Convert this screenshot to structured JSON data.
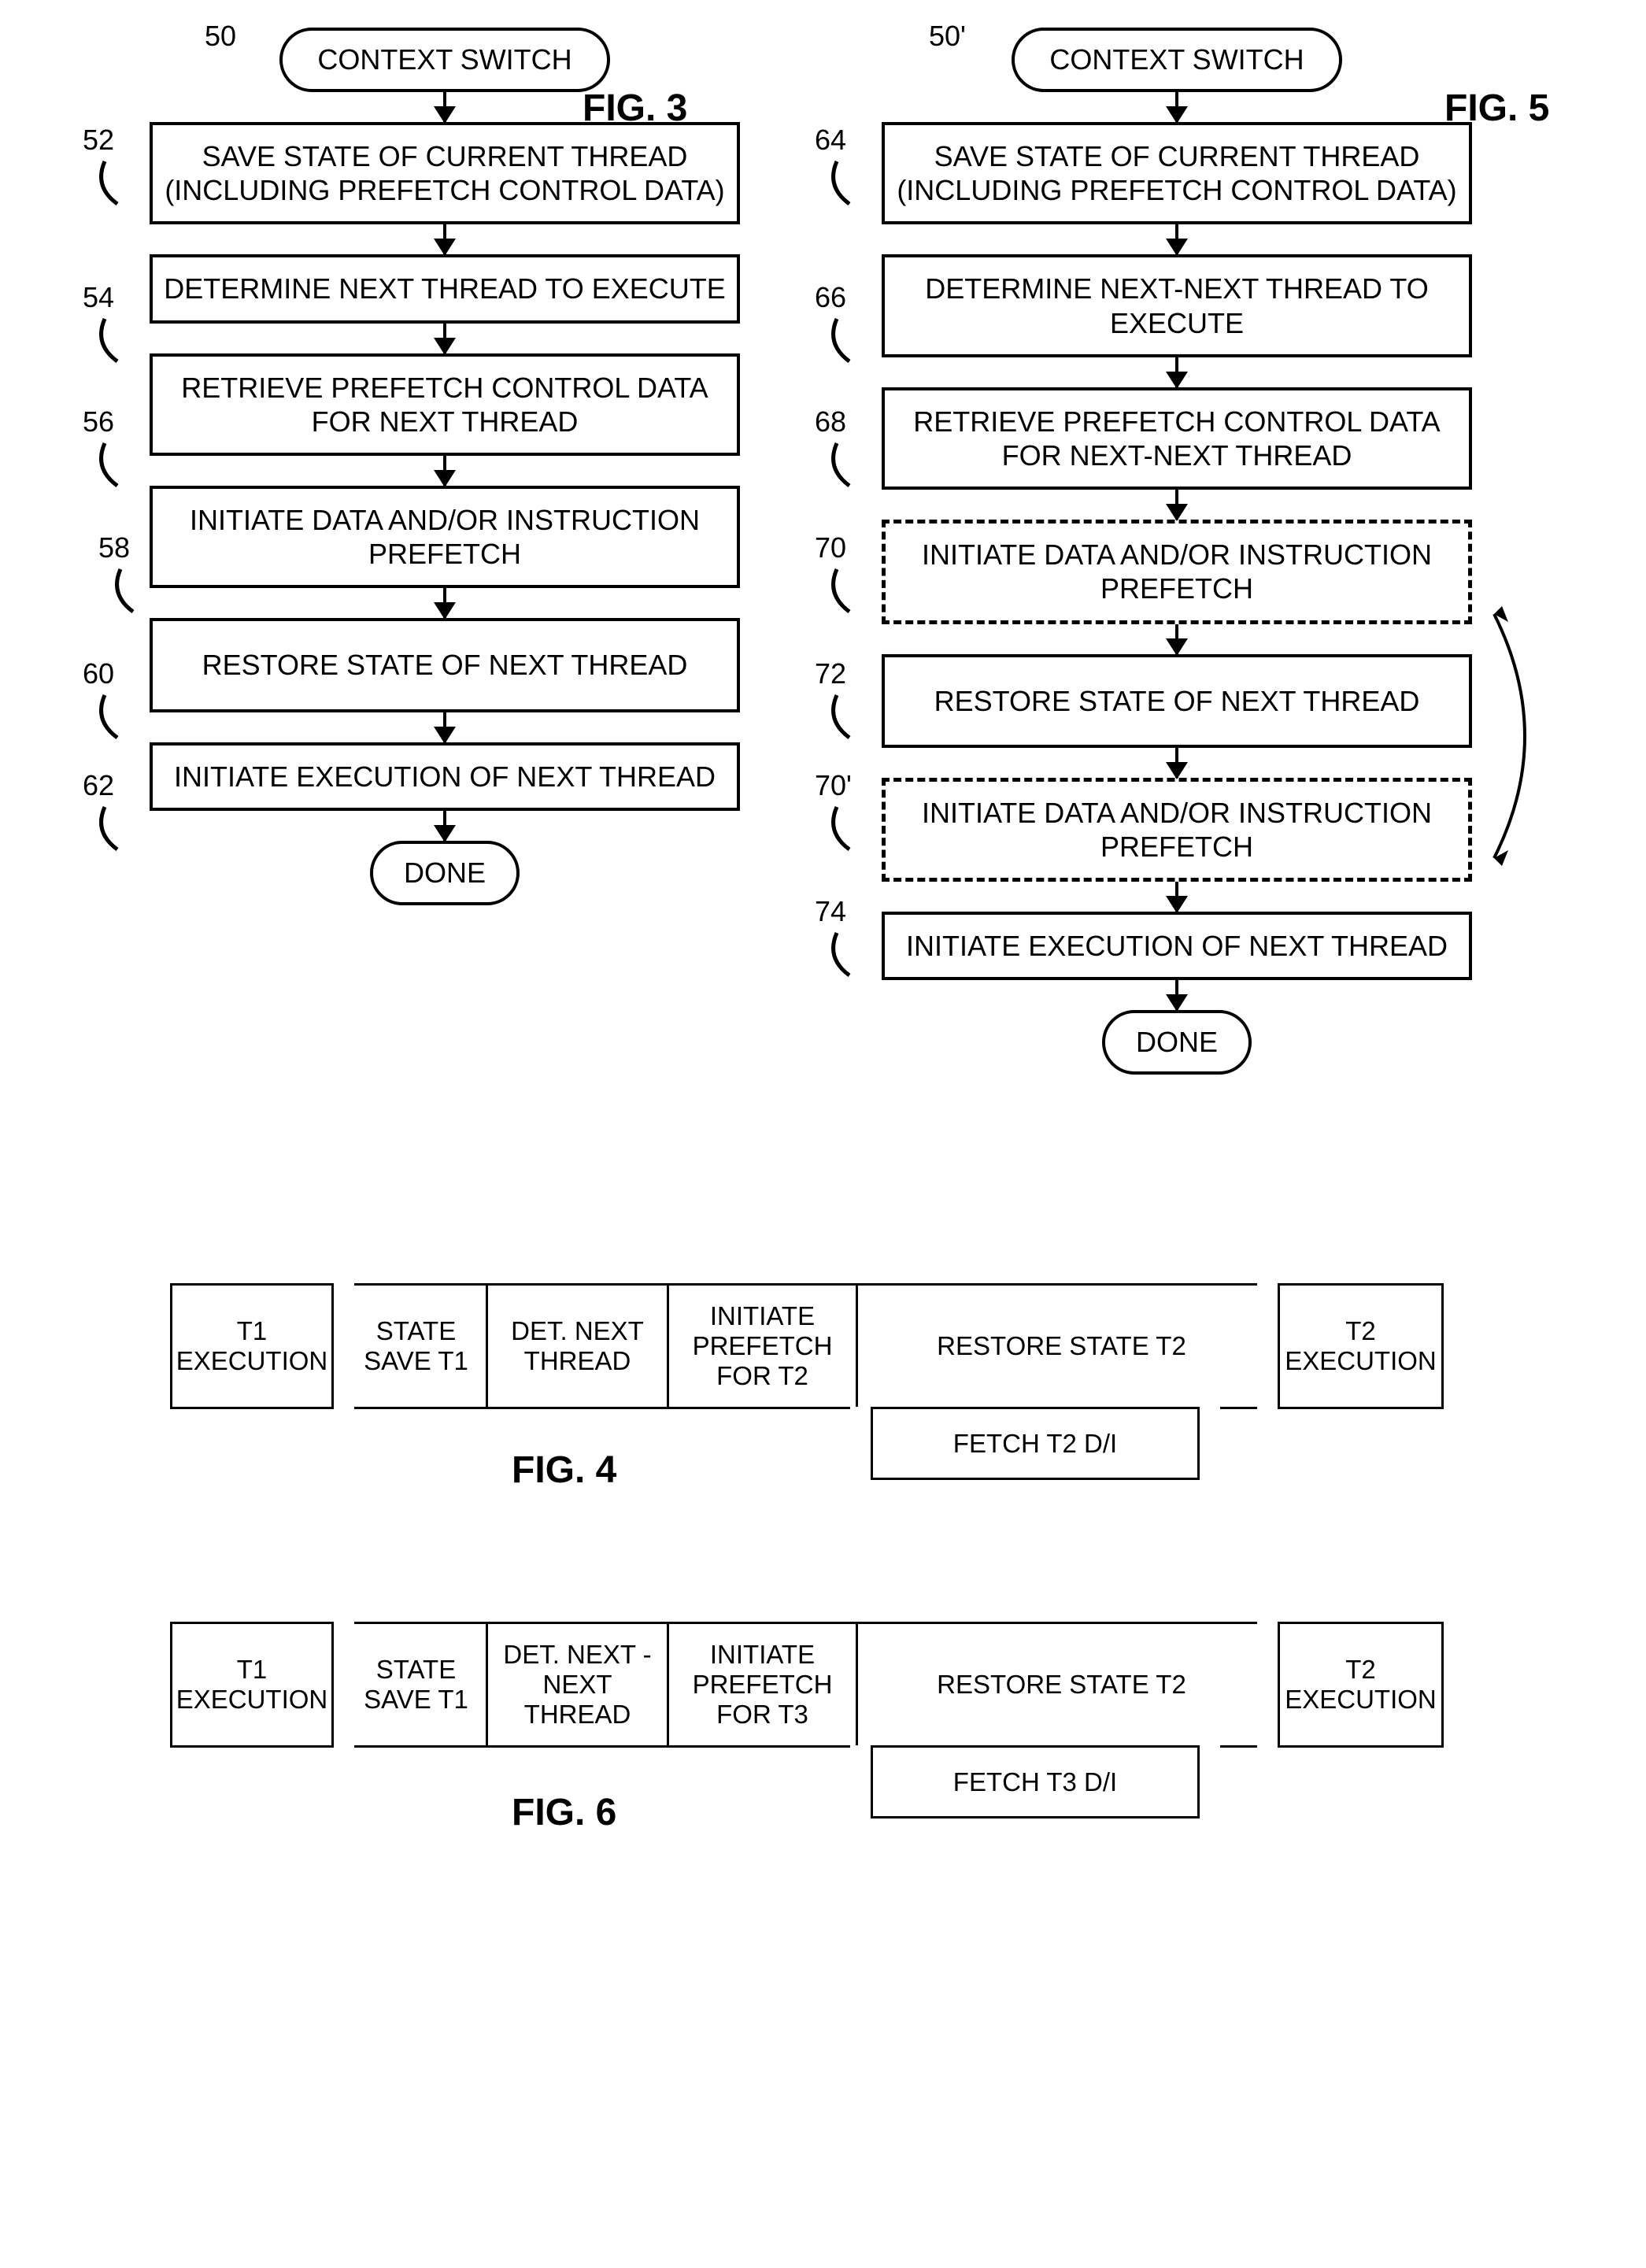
{
  "fig3": {
    "title": "FIG. 3",
    "start_ref": "50",
    "start": "CONTEXT SWITCH",
    "steps": [
      {
        "ref": "52",
        "text": "SAVE STATE OF CURRENT THREAD (INCLUDING PREFETCH CONTROL DATA)"
      },
      {
        "ref": "54",
        "text": "DETERMINE NEXT THREAD TO EXECUTE"
      },
      {
        "ref": "56",
        "text": "RETRIEVE PREFETCH CONTROL DATA FOR NEXT THREAD"
      },
      {
        "ref": "58",
        "text": "INITIATE DATA AND/OR INSTRUCTION PREFETCH"
      },
      {
        "ref": "60",
        "text": "RESTORE STATE OF NEXT THREAD"
      },
      {
        "ref": "62",
        "text": "INITIATE EXECUTION OF NEXT THREAD"
      }
    ],
    "end": "DONE"
  },
  "fig5": {
    "title": "FIG. 5",
    "start_ref": "50'",
    "start": "CONTEXT SWITCH",
    "steps": [
      {
        "ref": "64",
        "text": "SAVE STATE OF CURRENT THREAD (INCLUDING PREFETCH CONTROL DATA)",
        "dashed": false
      },
      {
        "ref": "66",
        "text": "DETERMINE NEXT-NEXT THREAD TO EXECUTE",
        "dashed": false
      },
      {
        "ref": "68",
        "text": "RETRIEVE PREFETCH CONTROL DATA FOR NEXT-NEXT THREAD",
        "dashed": false
      },
      {
        "ref": "70",
        "text": "INITIATE DATA AND/OR INSTRUCTION PREFETCH",
        "dashed": true
      },
      {
        "ref": "72",
        "text": "RESTORE STATE OF NEXT THREAD",
        "dashed": false
      },
      {
        "ref": "70'",
        "text": "INITIATE DATA AND/OR INSTRUCTION PREFETCH",
        "dashed": true
      },
      {
        "ref": "74",
        "text": "INITIATE EXECUTION OF NEXT THREAD",
        "dashed": false
      }
    ],
    "end": "DONE"
  },
  "fig4": {
    "title": "FIG. 4",
    "cells": [
      "T1 EXECUTION",
      "STATE SAVE T1",
      "DET. NEXT THREAD",
      "INITIATE PREFETCH FOR T2",
      "RESTORE STATE T2",
      "T2 EXECUTION"
    ],
    "under": "FETCH T2 D/I"
  },
  "fig6": {
    "title": "FIG. 6",
    "cells": [
      "T1 EXECUTION",
      "STATE SAVE T1",
      "DET. NEXT -NEXT THREAD",
      "INITIATE PREFETCH FOR T3",
      "RESTORE STATE T2",
      "T2 EXECUTION"
    ],
    "under": "FETCH T3 D/I"
  }
}
